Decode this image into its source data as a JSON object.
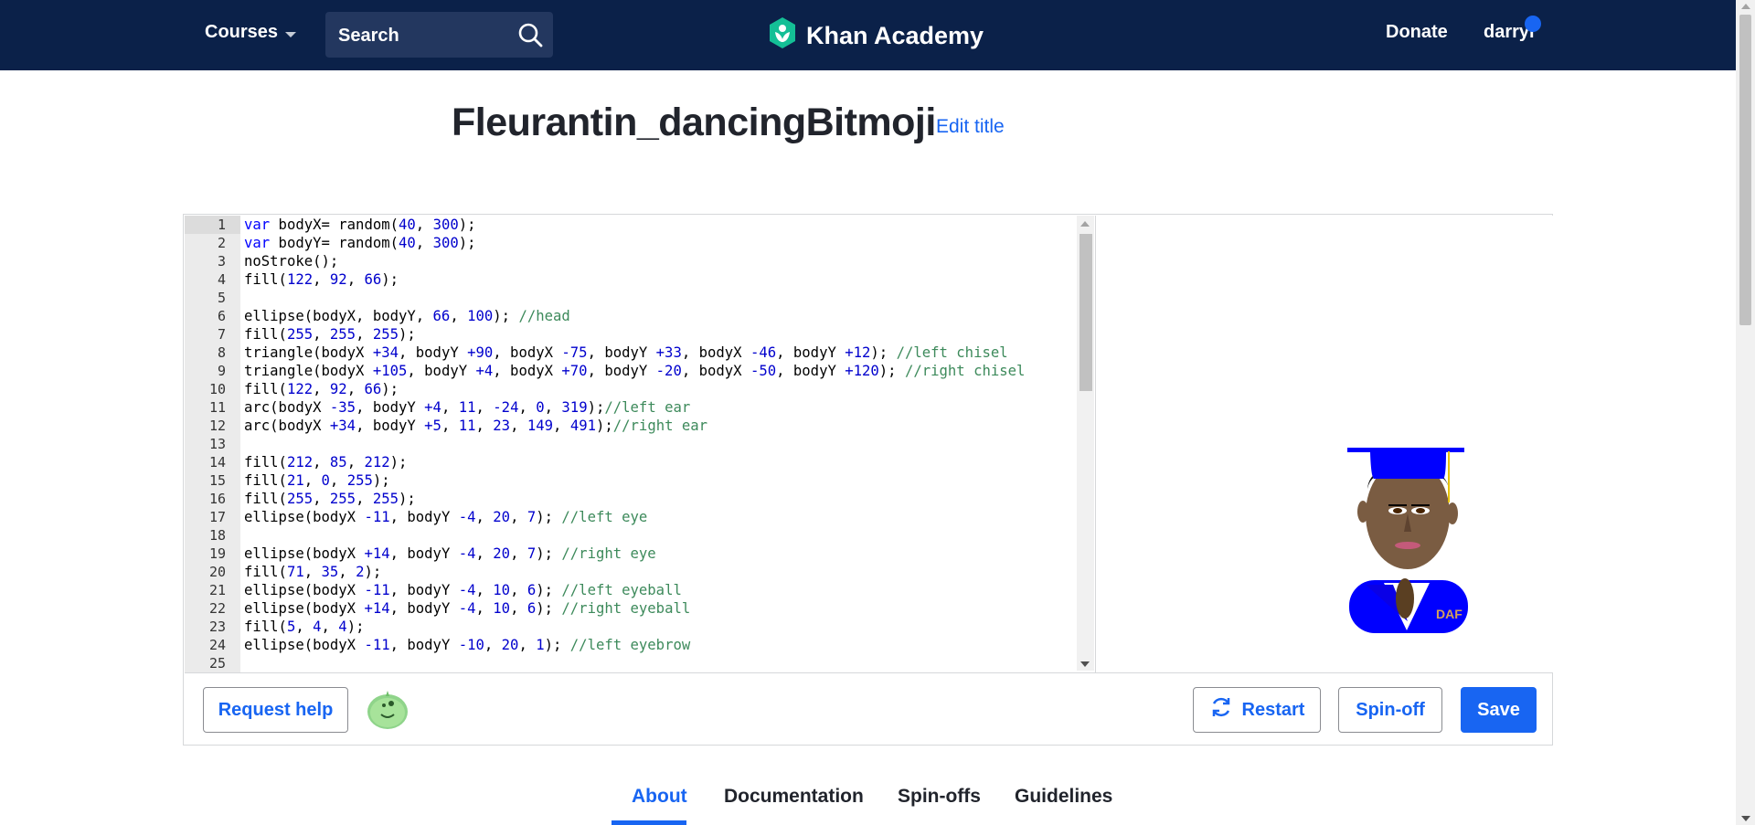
{
  "header": {
    "courses_label": "Courses",
    "search_placeholder": "Search",
    "logo_text": "Khan Academy",
    "donate_label": "Donate",
    "user_name": "darryl"
  },
  "program": {
    "title": "Fleurantin_dancingBitmoji",
    "edit_title_label": "Edit title"
  },
  "editor": {
    "line_numbers": [
      "1",
      "2",
      "3",
      "4",
      "5",
      "6",
      "7",
      "8",
      "9",
      "10",
      "11",
      "12",
      "13",
      "14",
      "15",
      "16",
      "17",
      "18",
      "19",
      "20",
      "21",
      "22",
      "23",
      "24",
      "25"
    ],
    "lines": [
      "var bodyX= random(40, 300);",
      "var bodyY= random(40, 300);",
      "noStroke();",
      "fill(122, 92, 66);",
      "",
      "ellipse(bodyX, bodyY, 66, 100); //head",
      "fill(255, 255, 255);",
      "triangle(bodyX +34, bodyY +90, bodyX -75, bodyY +33, bodyX -46, bodyY +12); //left chisel",
      "triangle(bodyX +105, bodyY +4, bodyX +70, bodyY -20, bodyX -50, bodyY +120); //right chisel",
      "fill(122, 92, 66);",
      "arc(bodyX -35, bodyY +4, 11, -24, 0, 319);//left ear",
      "arc(bodyX +34, bodyY +5, 11, 23, 149, 491);//right ear",
      "",
      "fill(212, 85, 212);",
      "fill(21, 0, 255);",
      "fill(255, 255, 255);",
      "ellipse(bodyX -11, bodyY -4, 20, 7); //left eye",
      "",
      "ellipse(bodyX +14, bodyY -4, 20, 7); //right eye",
      "fill(71, 35, 2);",
      "ellipse(bodyX -11, bodyY -4, 10, 6); //left eyeball",
      "ellipse(bodyX +14, bodyY -4, 10, 6); //right eyeball",
      "fill(5, 4, 4);",
      "ellipse(bodyX -11, bodyY -10, 20, 1); //left eyebrow",
      ""
    ]
  },
  "canvas": {
    "shirt_text": "DAF"
  },
  "toolbar": {
    "request_help_label": "Request help",
    "restart_label": "Restart",
    "spinoff_label": "Spin-off",
    "save_label": "Save"
  },
  "tabs": [
    {
      "label": "About",
      "active": true
    },
    {
      "label": "Documentation",
      "active": false
    },
    {
      "label": "Spin-offs",
      "active": false
    },
    {
      "label": "Guidelines",
      "active": false
    }
  ],
  "colors": {
    "header_bg": "#0b2149",
    "accent": "#1865f2",
    "logo_green": "#14bf96"
  }
}
